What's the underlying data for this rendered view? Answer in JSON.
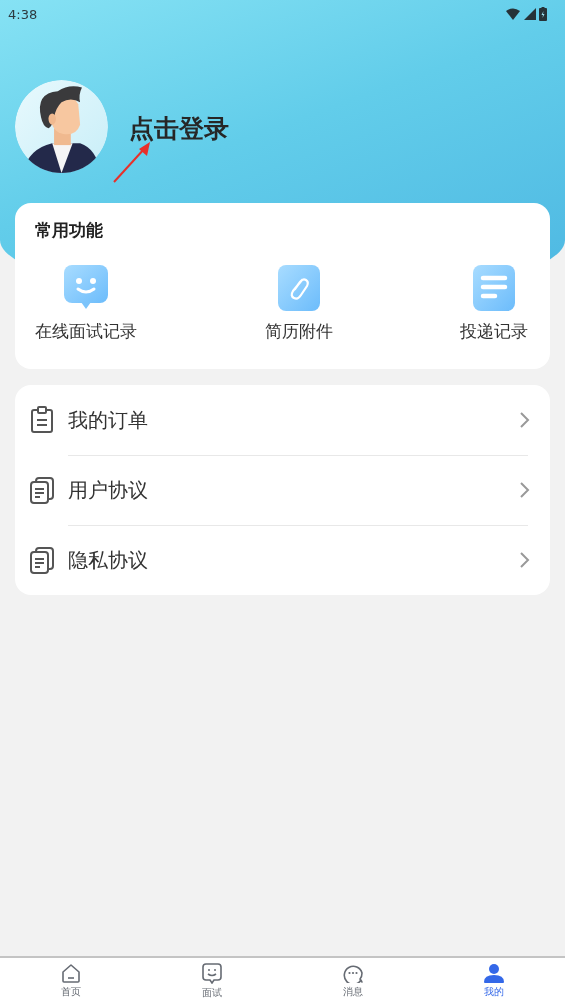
{
  "status_bar": {
    "time": "4:38"
  },
  "profile": {
    "login_text": "点击登录"
  },
  "common_functions": {
    "title": "常用功能",
    "items": [
      {
        "kind": "smile",
        "label": "在线面试记录"
      },
      {
        "kind": "clip",
        "label": "简历附件"
      },
      {
        "kind": "list",
        "label": "投递记录"
      }
    ]
  },
  "menu": [
    {
      "kind": "clipboard",
      "label": "我的订单"
    },
    {
      "kind": "documents",
      "label": "用户协议"
    },
    {
      "kind": "documents",
      "label": "隐私协议"
    }
  ],
  "tab_bar": [
    {
      "kind": "home",
      "label": "首页",
      "selected": false
    },
    {
      "kind": "interview",
      "label": "面试",
      "selected": false
    },
    {
      "kind": "message",
      "label": "消息",
      "selected": false
    },
    {
      "kind": "me",
      "label": "我的",
      "selected": true
    }
  ]
}
